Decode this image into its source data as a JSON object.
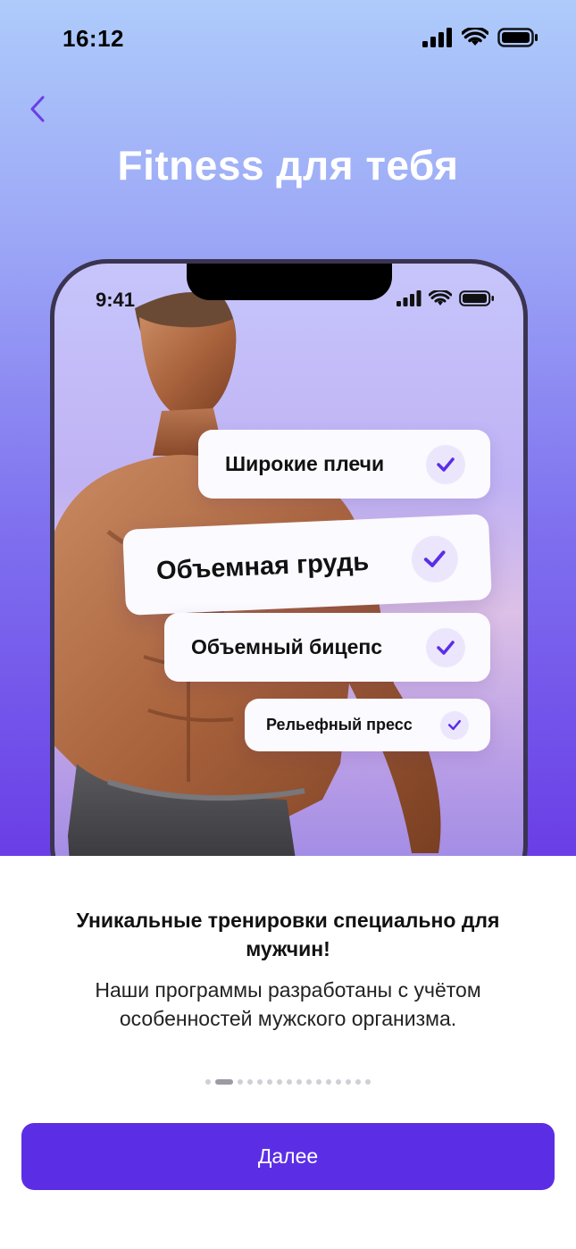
{
  "status_bar": {
    "time": "16:12"
  },
  "header": {
    "title": "Fitness для тебя",
    "back_icon": "chevron-left-icon"
  },
  "mockup": {
    "time": "9:41",
    "features": [
      {
        "label": "Широкие плечи"
      },
      {
        "label": "Объемная грудь"
      },
      {
        "label": "Объемный бицепс"
      },
      {
        "label": "Рельефный пресс"
      }
    ]
  },
  "content": {
    "headline": "Уникальные тренировки специально для мужчин!",
    "description": "Наши программы разработаны с учётом особенностей мужского организма."
  },
  "pagination": {
    "total": 16,
    "current": 2
  },
  "footer": {
    "next_label": "Далее"
  },
  "colors": {
    "accent": "#5b2ee6",
    "check": "#5b2ee6"
  }
}
